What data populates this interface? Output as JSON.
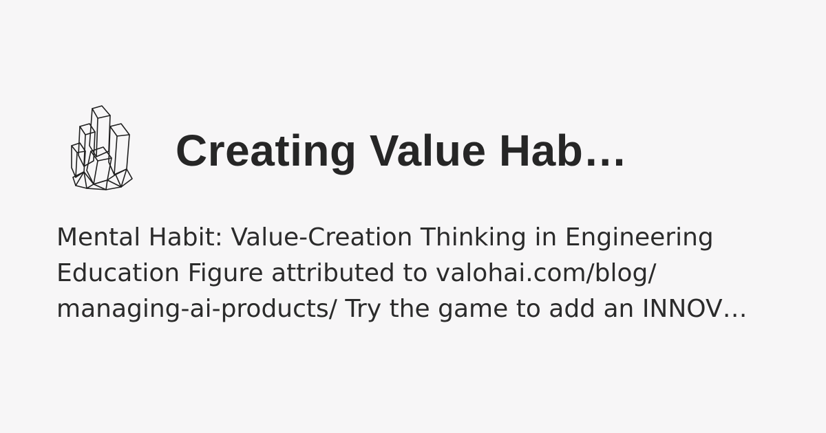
{
  "card": {
    "logo_icon": "crystal-cluster-icon",
    "title": "Creating Value Hab…",
    "description_lines": [
      "Mental Habit: Value-Creation Thinking in Engineering",
      "Education Figure attributed to valohai.com/blog/",
      "managing-ai-products/ Try the game to add an INNOV…"
    ]
  },
  "colors": {
    "background": "#f7f6f7",
    "text": "#262626"
  }
}
